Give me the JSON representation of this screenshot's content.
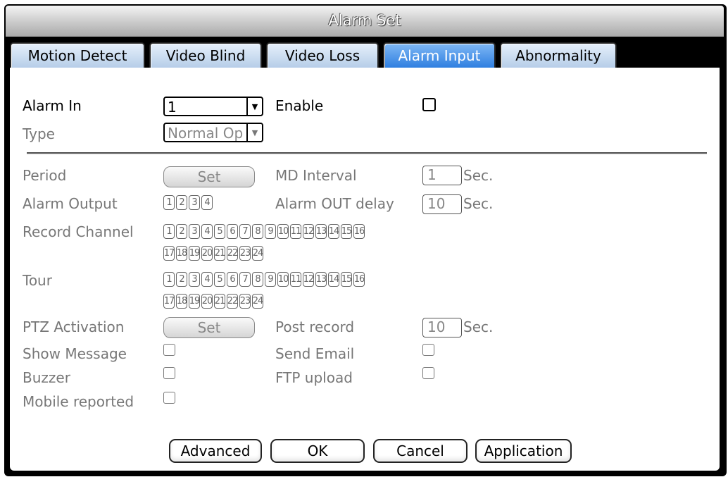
{
  "window": {
    "title": "Alarm Set"
  },
  "tabs": [
    {
      "label": "Motion Detect",
      "active": false
    },
    {
      "label": "Video Blind",
      "active": false
    },
    {
      "label": "Video Loss",
      "active": false
    },
    {
      "label": "Alarm Input",
      "active": true
    },
    {
      "label": "Abnormality",
      "active": false
    }
  ],
  "form": {
    "alarm_in_label": "Alarm In",
    "alarm_in_value": "1",
    "enable_label": "Enable",
    "enable_checked": false,
    "type_label": "Type",
    "type_value": "Normal Op",
    "period_label": "Period",
    "period_button": "Set",
    "md_interval_label": "MD Interval",
    "md_interval_value": "1",
    "md_interval_unit": "Sec.",
    "alarm_output_label": "Alarm Output",
    "alarm_output_channels": [
      "1",
      "2",
      "3",
      "4"
    ],
    "alarm_out_delay_label": "Alarm OUT delay",
    "alarm_out_delay_value": "10",
    "alarm_out_delay_unit": "Sec.",
    "record_channel_label": "Record Channel",
    "record_channels_row1": [
      "1",
      "2",
      "3",
      "4",
      "5",
      "6",
      "7",
      "8",
      "9",
      "10",
      "11",
      "12",
      "13",
      "14",
      "15",
      "16"
    ],
    "record_channels_row2": [
      "17",
      "18",
      "19",
      "20",
      "21",
      "22",
      "23",
      "24"
    ],
    "tour_label": "Tour",
    "tour_channels_row1": [
      "1",
      "2",
      "3",
      "4",
      "5",
      "6",
      "7",
      "8",
      "9",
      "10",
      "11",
      "12",
      "13",
      "14",
      "15",
      "16"
    ],
    "tour_channels_row2": [
      "17",
      "18",
      "19",
      "20",
      "21",
      "22",
      "23",
      "24"
    ],
    "ptz_activation_label": "PTZ Activation",
    "ptz_button": "Set",
    "post_record_label": "Post record",
    "post_record_value": "10",
    "post_record_unit": "Sec.",
    "show_message_label": "Show Message",
    "send_email_label": "Send Email",
    "buzzer_label": "Buzzer",
    "ftp_upload_label": "FTP upload",
    "mobile_reported_label": "Mobile reported"
  },
  "buttons": {
    "advanced": "Advanced",
    "ok": "OK",
    "cancel": "Cancel",
    "application": "Application"
  }
}
